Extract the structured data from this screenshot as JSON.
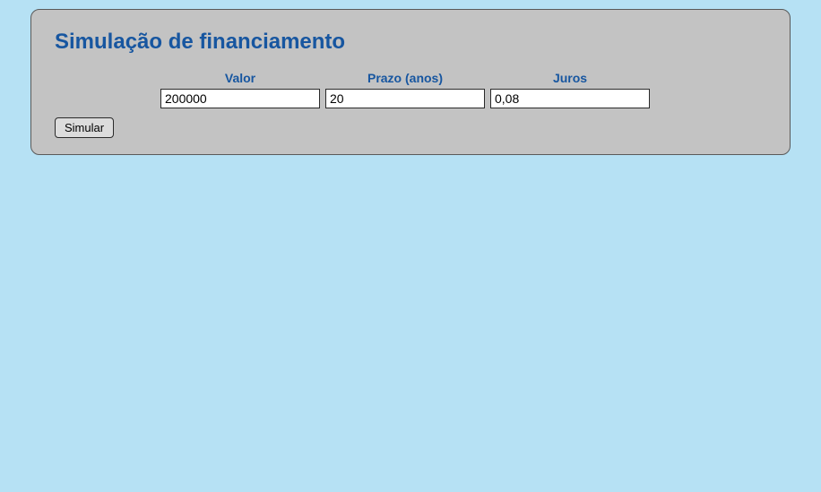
{
  "form": {
    "title": "Simulação de financiamento",
    "fields": {
      "valor": {
        "label": "Valor",
        "value": "200000"
      },
      "prazo": {
        "label": "Prazo (anos)",
        "value": "20"
      },
      "juros": {
        "label": "Juros",
        "value": "0,08"
      }
    },
    "submit_label": "Simular"
  }
}
